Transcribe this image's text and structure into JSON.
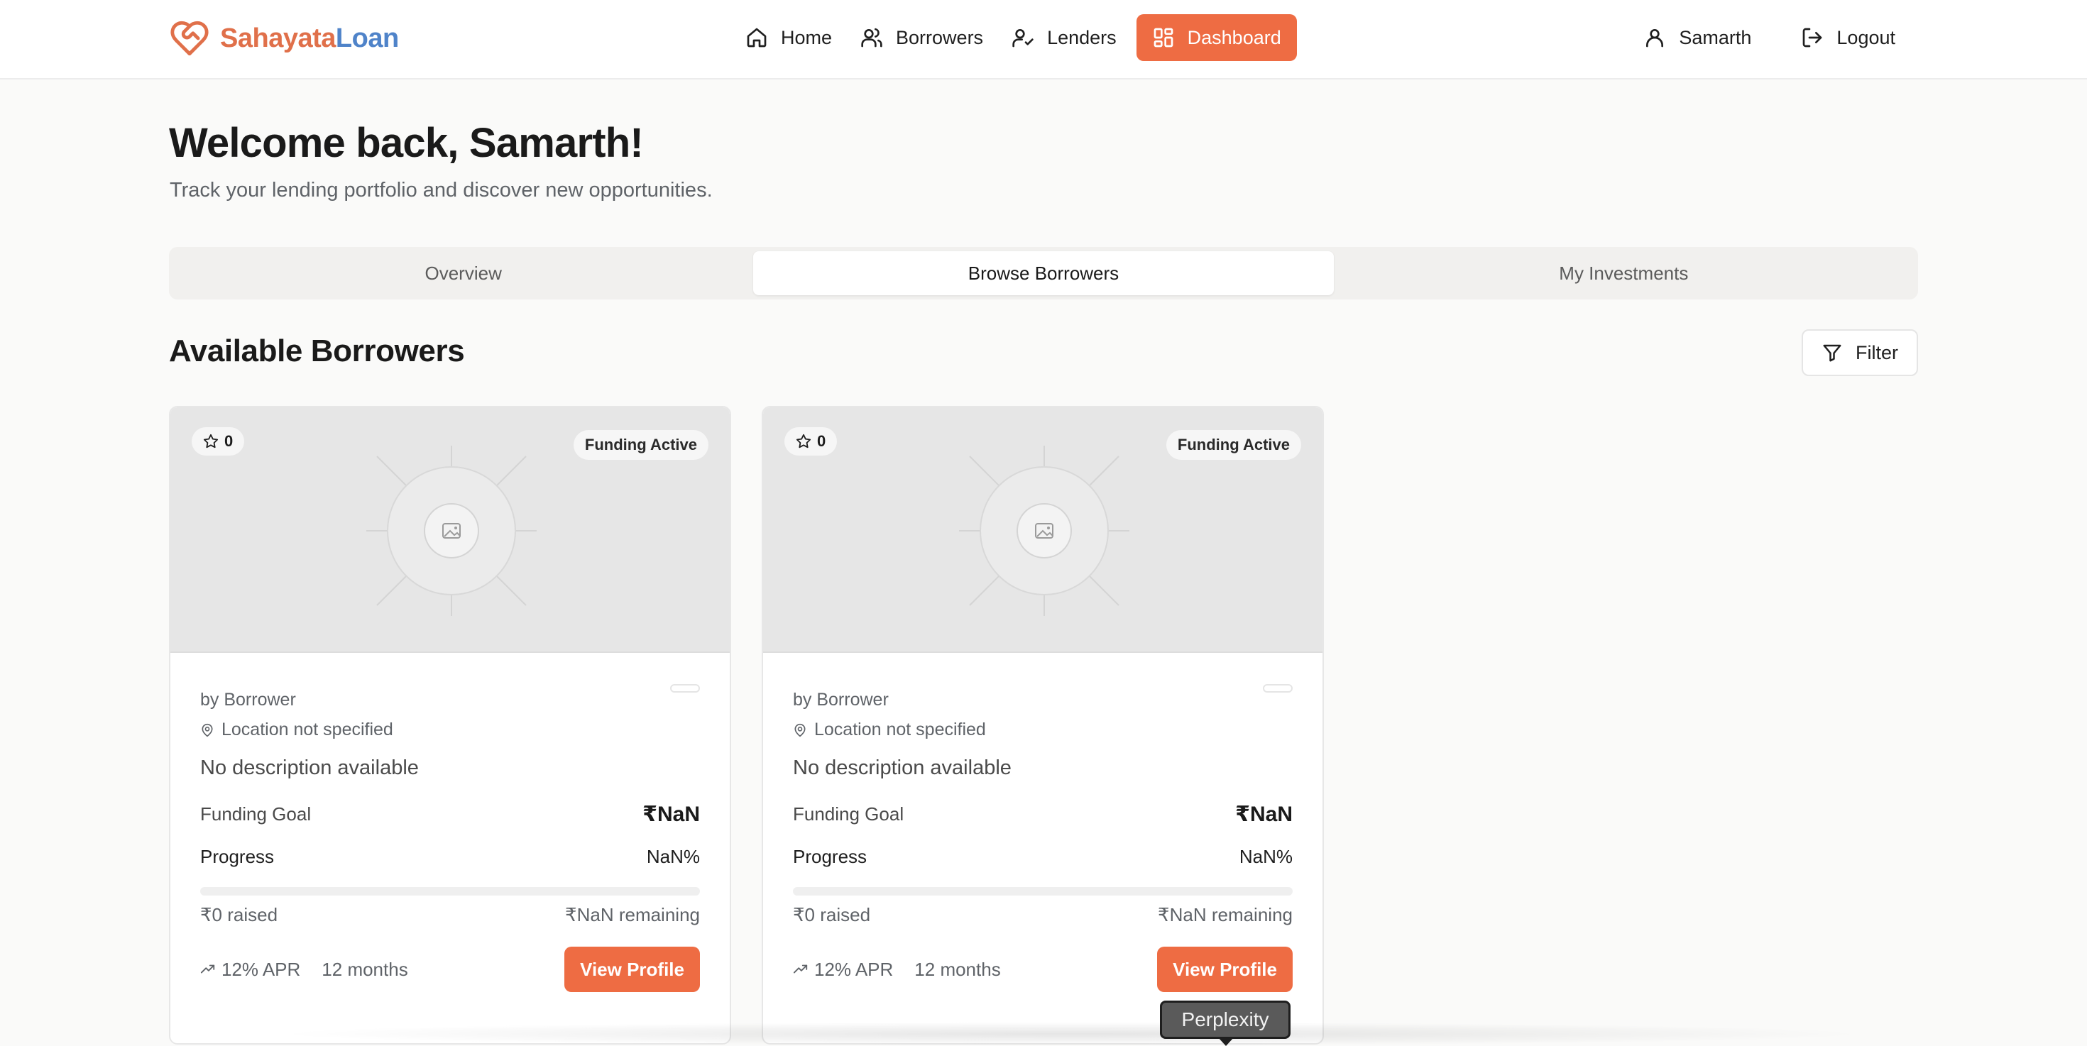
{
  "app": {
    "brand_part1": "Sahayata",
    "brand_part2": "Loan",
    "accent": "#ee6c43",
    "brand_blue": "#4f83c9"
  },
  "nav": {
    "items": [
      {
        "label": "Home",
        "icon": "home-icon"
      },
      {
        "label": "Borrowers",
        "icon": "users-icon"
      },
      {
        "label": "Lenders",
        "icon": "user-check-icon"
      },
      {
        "label": "Dashboard",
        "icon": "dashboard-grid-icon",
        "active": true
      }
    ],
    "user_name": "Samarth",
    "logout_label": "Logout"
  },
  "intro": {
    "welcome": "Welcome back, Samarth!",
    "subtitle": "Track your lending portfolio and discover new opportunities."
  },
  "tabs": [
    {
      "label": "Overview"
    },
    {
      "label": "Browse Borrowers",
      "active": true
    },
    {
      "label": "My Investments"
    }
  ],
  "section": {
    "title": "Available Borrowers",
    "filter_label": "Filter"
  },
  "cards": [
    {
      "rating": "0",
      "status": "Funding Active",
      "by": "by Borrower",
      "location": "Location not specified",
      "description": "No description available",
      "goal_label": "Funding Goal",
      "goal_value": "₹NaN",
      "progress_label": "Progress",
      "progress_value": "NaN%",
      "progress_fraction": 0,
      "raised": "₹0 raised",
      "remaining": "₹NaN remaining",
      "apr": "12% APR",
      "term": "12 months",
      "cta": "View Profile"
    },
    {
      "rating": "0",
      "status": "Funding Active",
      "by": "by Borrower",
      "location": "Location not specified",
      "description": "No description available",
      "goal_label": "Funding Goal",
      "goal_value": "₹NaN",
      "progress_label": "Progress",
      "progress_value": "NaN%",
      "progress_fraction": 0,
      "raised": "₹0 raised",
      "remaining": "₹NaN remaining",
      "apr": "12% APR",
      "term": "12 months",
      "cta": "View Profile"
    }
  ],
  "tooltip": {
    "label": "Perplexity"
  }
}
